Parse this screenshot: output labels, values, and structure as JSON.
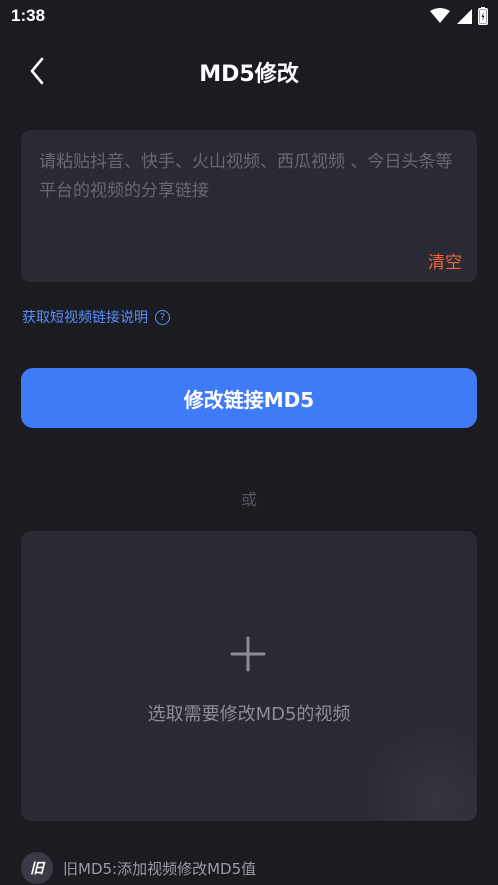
{
  "status_bar": {
    "time": "1:38",
    "icons": [
      "wifi-icon",
      "signal-icon",
      "battery-icon"
    ]
  },
  "header": {
    "title": "MD5修改",
    "back_icon": "chevron-left-icon"
  },
  "link_input": {
    "value": "",
    "placeholder": "请粘贴抖音、快手、火山视频、西瓜视频 、今日头条等平台的视频的分享链接",
    "clear_label": "清空"
  },
  "help_link": {
    "label": "获取短视频链接说明",
    "icon": "question-circle-icon",
    "icon_glyph": "?"
  },
  "modify_button": {
    "label": "修改链接MD5"
  },
  "divider": {
    "label": "或"
  },
  "upload": {
    "icon": "plus-icon",
    "label": "选取需要修改MD5的视频"
  },
  "footer": {
    "badge": "旧",
    "text": "旧MD5:添加视频修改MD5值"
  },
  "colors": {
    "background": "#1b1b22",
    "card": "#2a2a35",
    "accent": "#3f7bf7",
    "link": "#5c8ff6",
    "danger": "#f4623f"
  }
}
